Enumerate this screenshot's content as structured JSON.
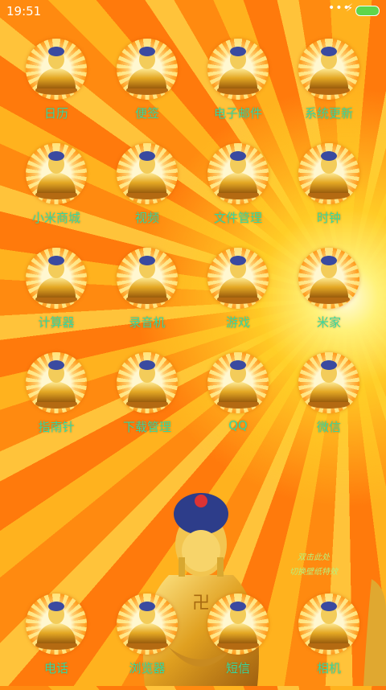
{
  "status_bar": {
    "time": "19:51",
    "dots": "•••",
    "charging_icon": "bolt-icon"
  },
  "apps": [
    {
      "label": "日历"
    },
    {
      "label": "便签"
    },
    {
      "label": "电子邮件"
    },
    {
      "label": "系统更新"
    },
    {
      "label": "小米商城"
    },
    {
      "label": "视频"
    },
    {
      "label": "文件管理"
    },
    {
      "label": "时钟"
    },
    {
      "label": "计算器"
    },
    {
      "label": "录音机"
    },
    {
      "label": "游戏"
    },
    {
      "label": "米家"
    },
    {
      "label": "指南针"
    },
    {
      "label": "下载管理"
    },
    {
      "label": "QQ"
    },
    {
      "label": "微信"
    }
  ],
  "dock": [
    {
      "label": "电话"
    },
    {
      "label": "浏览器"
    },
    {
      "label": "短信"
    },
    {
      "label": "相机"
    }
  ],
  "watermark": {
    "line1": "双击此处",
    "line2": "切换壁纸特效"
  },
  "colors": {
    "label": "#38d9a0",
    "gold": "#e8b020",
    "battery": "#5fd64a"
  }
}
